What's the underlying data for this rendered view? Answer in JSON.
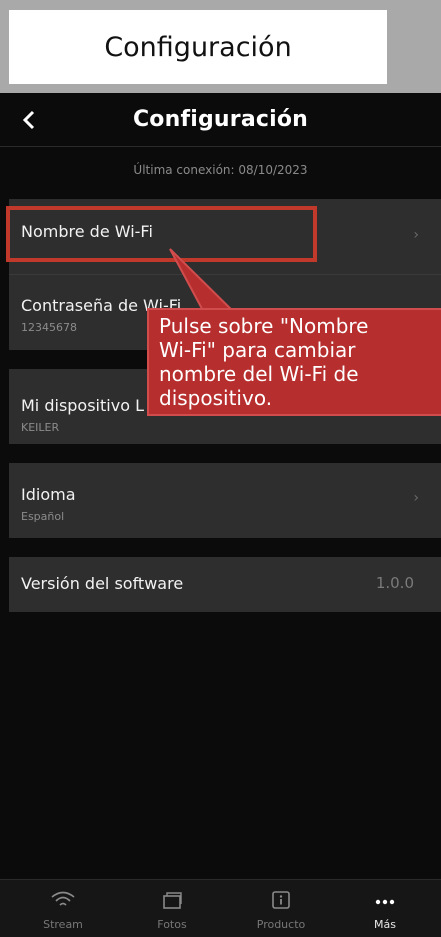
{
  "top_label": "Configuración",
  "header": {
    "title": "Configuración"
  },
  "last_connection": "Última conexión: 08/10/2023",
  "rows": [
    {
      "label": "Nombre de Wi-Fi",
      "sub": "",
      "chevron": "›"
    },
    {
      "label": "Contraseña de Wi-Fi",
      "sub": "12345678"
    },
    {
      "label": "Mi dispositivo L",
      "sub": "KEILER"
    },
    {
      "label": "Idioma",
      "sub": "Español",
      "chevron": "›"
    },
    {
      "label": "Versión del software",
      "value": "1.0.0"
    }
  ],
  "callout": {
    "line1": "Pulse sobre \"Nombre",
    "line2": "Wi-Fi\" para cambiar",
    "line3": "nombre del Wi-Fi de",
    "line4": "dispositivo."
  },
  "tabs": [
    {
      "label": "Stream",
      "icon": "wifi-icon"
    },
    {
      "label": "Fotos",
      "icon": "photos-icon"
    },
    {
      "label": "Producto",
      "icon": "info-icon"
    },
    {
      "label": "Más",
      "icon": "more-icon",
      "active": true
    }
  ],
  "colors": {
    "accent_red": "#c0392b",
    "screen_bg": "#0b0b0b",
    "row_bg": "#2e2e2e"
  }
}
